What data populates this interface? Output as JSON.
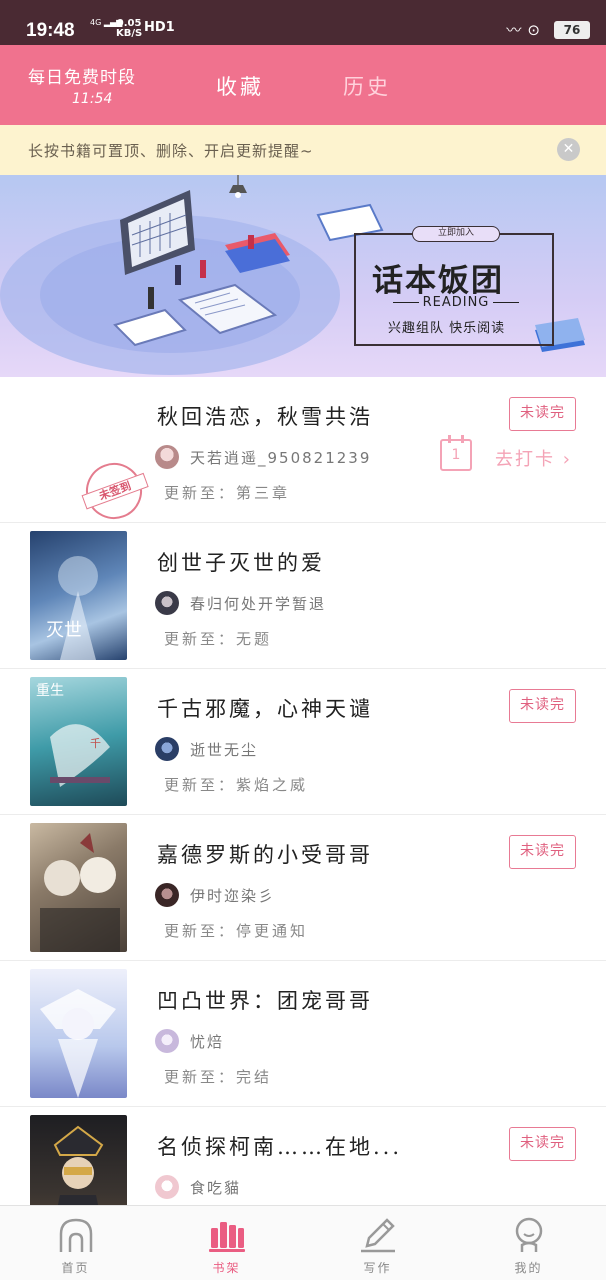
{
  "status_bar": {
    "time": "19:48",
    "signal_label": "4G",
    "speed_value": "0.05",
    "speed_unit": "KB/S",
    "hd_label": "HD1",
    "battery": "76"
  },
  "header": {
    "free_title": "每日免费时段",
    "free_time": "11:54",
    "tabs": [
      {
        "label": "收藏",
        "active": true
      },
      {
        "label": "历史",
        "active": false
      }
    ]
  },
  "tip": {
    "text": "长按书籍可置顶、删除、开启更新提醒~"
  },
  "banner": {
    "tag": "立即加入",
    "title": "话本饭团",
    "subtitle": "READING",
    "slogan": "兴趣组队 快乐阅读"
  },
  "books": [
    {
      "title": "秋回浩恋，秋雪共浩",
      "author": "天若逍遥_950821239",
      "update": "更新至：第三章",
      "unread_label": "未读完",
      "has_cover": false,
      "checkin_day": "1",
      "checkin_label": "去打卡",
      "stamp_label": "未签到",
      "cover_colors": [],
      "avatar_color": "#b88a8a"
    },
    {
      "title": "创世子灭世的爱",
      "author": "春归何处开学暂退",
      "update": "更新至：无题",
      "unread_label": "",
      "has_cover": true,
      "cover_colors": [
        "#26426e",
        "#5f86b8",
        "#a8c4e2"
      ],
      "avatar_color": "#3a3a48"
    },
    {
      "title": "千古邪魔，心神天谴",
      "author": "逝世无尘",
      "update": "更新至：紫焰之威",
      "unread_label": "未读完",
      "has_cover": true,
      "cover_colors": [
        "#3f9ba8",
        "#a6d7de",
        "#c0504d"
      ],
      "avatar_color": "#2a3e66"
    },
    {
      "title": "嘉德罗斯的小受哥哥",
      "author": "伊时迩染彡",
      "update": "更新至：停更通知",
      "unread_label": "未读完",
      "has_cover": true,
      "cover_colors": [
        "#4a4038",
        "#c9b9a2",
        "#8a3a3a"
      ],
      "avatar_color": "#3a2626"
    },
    {
      "title": "凹凸世界：团宠哥哥",
      "author": "忧焙",
      "update": "更新至：完结",
      "unread_label": "",
      "has_cover": true,
      "cover_colors": [
        "#b8c8ec",
        "#eef0fb",
        "#7a88c8"
      ],
      "avatar_color": "#c8b8dc"
    },
    {
      "title": "名侦探柯南……在地...",
      "author": "食吃貓",
      "update": "",
      "unread_label": "未读完",
      "has_cover": true,
      "cover_colors": [
        "#1e1e22",
        "#d4a848",
        "#5a4a3a"
      ],
      "avatar_color": "#f0c8d0"
    }
  ],
  "bottom_nav": [
    {
      "label": "首页",
      "icon": "home-icon",
      "active": false
    },
    {
      "label": "书架",
      "icon": "bookshelf-icon",
      "active": true
    },
    {
      "label": "写作",
      "icon": "pencil-icon",
      "active": false
    },
    {
      "label": "我的",
      "icon": "profile-icon",
      "active": false
    }
  ],
  "colors": {
    "status_bar": "#4a2a33",
    "header": "#f0728e",
    "accent": "#e0607f",
    "tip_bg": "#fdf3cf"
  }
}
